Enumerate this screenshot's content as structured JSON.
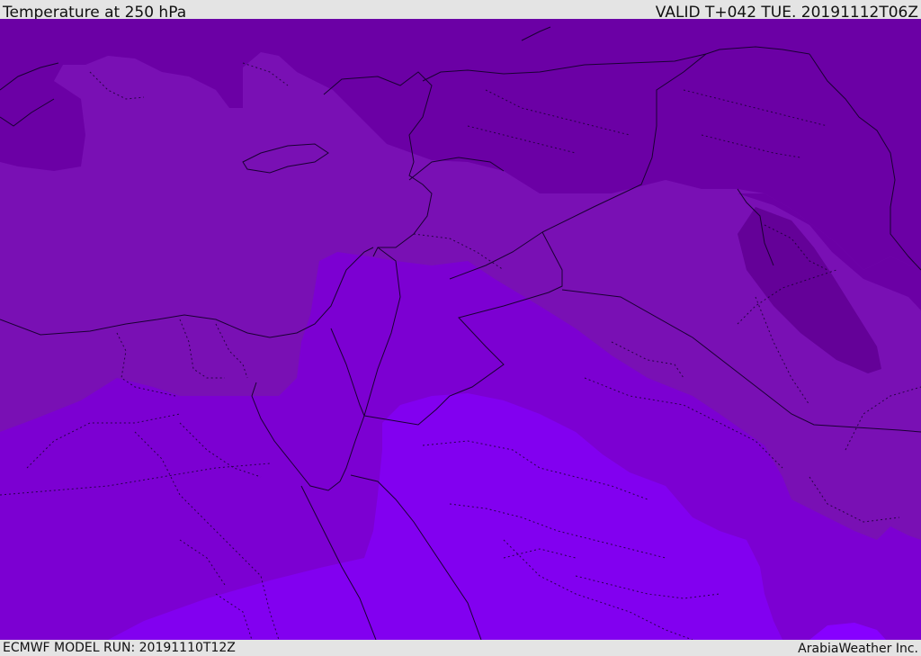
{
  "header": {
    "title": "Temperature at 250 hPa",
    "valid_time": "VALID T+042 TUE. 20191112T06Z"
  },
  "footer": {
    "model_run": "ECMWF MODEL RUN: 20191110T12Z",
    "credit": "ArabiaWeather Inc."
  },
  "map": {
    "field": "Temperature at 250 hPa",
    "color_levels": [
      "#5e0196",
      "#6b00a5",
      "#7910b4",
      "#7c00d2",
      "#8200f0",
      "#8700ff"
    ]
  }
}
